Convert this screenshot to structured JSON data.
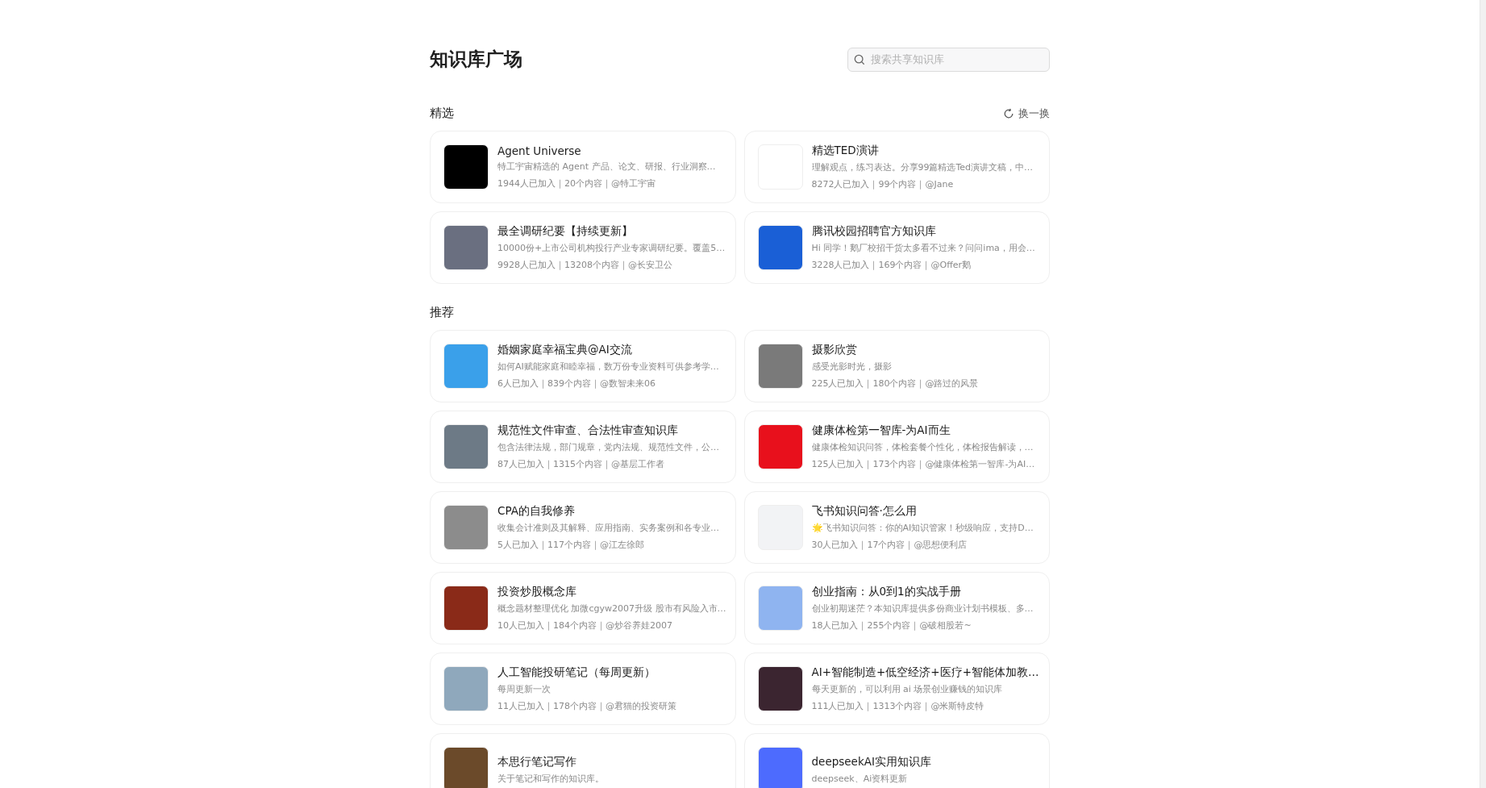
{
  "page": {
    "title": "知识库广场"
  },
  "search": {
    "placeholder": "搜索共享知识库"
  },
  "sections": [
    {
      "heading": "精选",
      "action": "换一换",
      "items": [
        {
          "title": "Agent Universe",
          "desc": "特工宇宙精选的 Agent 产品、论文、研报、行业洞察…",
          "meta": "1944人已加入｜20个内容｜@特工宇宙",
          "color": "#000000"
        },
        {
          "title": "精选TED演讲",
          "desc": "理解观点，练习表达。分享99篇精选Ted演讲文稿，中…",
          "meta": "8272人已加入｜99个内容｜@Jane",
          "color": "#ffffff"
        },
        {
          "title": "最全调研纪要【持续更新】",
          "desc": "10000份+上市公司机构投行产业专家调研纪要。覆盖5…",
          "meta": "9928人已加入｜13208个内容｜@长安卫公",
          "color": "#6a6f80"
        },
        {
          "title": "腾讯校园招聘官方知识库",
          "desc": "Hi 同学！鹅厂校招干货太多看不过来？问问ima，用会…",
          "meta": "3228人已加入｜169个内容｜@Offer鹅",
          "color": "#1a5fd6"
        }
      ]
    },
    {
      "heading": "推荐",
      "items": [
        {
          "title": "婚姻家庭幸福宝典@AI交流",
          "desc": "如何AI赋能家庭和睦幸福，数万份专业资料可供参考学…",
          "meta": "6人已加入｜839个内容｜@数智未来06",
          "color": "#3aa0ea"
        },
        {
          "title": "摄影欣赏",
          "desc": "感受光影时光，摄影",
          "meta": "225人已加入｜180个内容｜@路过的风景",
          "color": "#7a7a7a"
        },
        {
          "title": "规范性文件审查、合法性审查知识库",
          "desc": "包含法律法规，部门规章，党内法规、规范性文件，公…",
          "meta": "87人已加入｜1315个内容｜@基层工作者",
          "color": "#6d7a86"
        },
        {
          "title": "健康体检第一智库-为AI而生",
          "desc": "健康体检知识问答，体检套餐个性化，体检报告解读，…",
          "meta": "125人已加入｜173个内容｜@健康体检第一智库-为AI…",
          "color": "#e8101c"
        },
        {
          "title": "CPA的自我修养",
          "desc": "收集会计准则及其解释、应用指南、实务案例和各专业…",
          "meta": "5人已加入｜117个内容｜@江左徐郎",
          "color": "#8c8c8c"
        },
        {
          "title": "飞书知识问答·怎么用",
          "desc": "🌟飞书知识问答：你的AI知识管家！秒级响应，支持D…",
          "meta": "30人已加入｜17个内容｜@思想便利店",
          "color": "#f2f3f5"
        },
        {
          "title": "投资炒股概念库",
          "desc": "概念题材整理优化 加微cgyw2007升级 股市有风险入市…",
          "meta": "10人已加入｜184个内容｜@炒谷养娃2007",
          "color": "#8a2a18"
        },
        {
          "title": "创业指南：从0到1的实战手册",
          "desc": "创业初期迷茫？本知识库提供多份商业计划书模板、多…",
          "meta": "18人已加入｜255个内容｜@破相股若~",
          "color": "#8fb4f0"
        },
        {
          "title": "人工智能投研笔记（每周更新）",
          "desc": "每周更新一次",
          "meta": "11人已加入｜178个内容｜@君猫的投资研策",
          "color": "#8fa8bc"
        },
        {
          "title": "AI+智能制造+低空经济+医疗+智能体加教…",
          "desc": "每天更新的，可以利用 ai 场景创业赚钱的知识库",
          "meta": "111人已加入｜1313个内容｜@米斯特皮特",
          "color": "#3b2530"
        },
        {
          "title": "本思行笔记写作",
          "desc": "关于笔记和写作的知识库。",
          "color": "#6b4a2a"
        },
        {
          "title": "deepseekAI实用知识库",
          "desc": "deepseek、Ai资料更新",
          "color": "#4d6bfe"
        }
      ]
    }
  ]
}
